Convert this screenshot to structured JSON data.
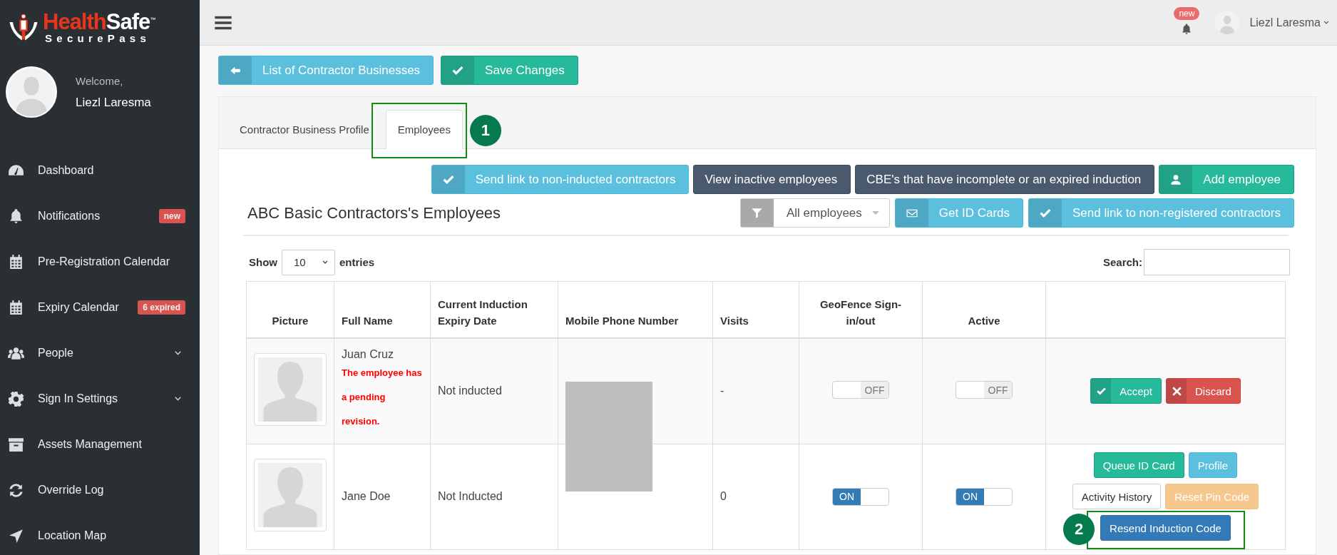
{
  "logo": {
    "name_red": "Health",
    "name_white": "Safe",
    "trademark": "™",
    "tagline": "SecurePass"
  },
  "profile": {
    "greeting": "Welcome,",
    "name": "Liezl Laresma"
  },
  "sidebar": {
    "items": [
      {
        "label": "Dashboard"
      },
      {
        "label": "Notifications",
        "badge": "new"
      },
      {
        "label": "Pre-Registration Calendar"
      },
      {
        "label": "Expiry Calendar",
        "badge": "6 expired"
      },
      {
        "label": "People",
        "expandable": true
      },
      {
        "label": "Sign In Settings",
        "expandable": true
      },
      {
        "label": "Assets Management"
      },
      {
        "label": "Override Log"
      },
      {
        "label": "Location Map"
      }
    ]
  },
  "topbar": {
    "notification_badge": "new",
    "user": "Liezl Laresma"
  },
  "page_actions": [
    {
      "label": "List of Contractor Businesses"
    },
    {
      "label": "Save Changes"
    }
  ],
  "tabs": [
    {
      "label": "Contractor Business Profile",
      "selected": false
    },
    {
      "label": "Employees",
      "selected": true,
      "callout": "1"
    }
  ],
  "toolbar": [
    {
      "label": "Send link to non-inducted contractors"
    },
    {
      "label": "View inactive employees"
    },
    {
      "label": "CBE's that have incomplete or an expired induction"
    },
    {
      "label": "Add employee"
    }
  ],
  "heading": "ABC Basic Contractors's Employees",
  "filter": {
    "value": "All employees"
  },
  "toolbar_2": [
    {
      "label": "Get ID Cards"
    },
    {
      "label": "Send link to non-registered contractors"
    }
  ],
  "length": {
    "prefix": "Show",
    "value": "10",
    "suffix": "entries"
  },
  "search": {
    "label": "Search:"
  },
  "table": {
    "columns": [
      "Picture",
      "Full Name",
      "Current Induction Expiry Date",
      "Mobile Phone Number",
      "Visits",
      "GeoFence Sign-in/out",
      "Active"
    ],
    "rows": [
      {
        "full_name": "Juan Cruz",
        "note": "The employee has a pending revision.",
        "expiry": "Not inducted",
        "visits": "-",
        "geofence": {
          "on": false,
          "label": "OFF"
        },
        "active": {
          "on": false,
          "label": "OFF"
        },
        "actions": [
          [
            {
              "label": "Accept"
            },
            {
              "label": "Discard"
            }
          ]
        ]
      },
      {
        "full_name": "Jane Doe",
        "expiry": "Not Inducted",
        "visits": "0",
        "geofence": {
          "on": true,
          "label": "ON"
        },
        "active": {
          "on": true,
          "label": "ON"
        },
        "actions": [
          [
            {
              "label": "Queue ID Card"
            },
            {
              "label": "Profile"
            }
          ],
          [
            {
              "label": "Activity History"
            },
            {
              "label": "Reset Pin Code"
            }
          ],
          [
            {
              "label": "Resend Induction Code",
              "callout": "2"
            }
          ]
        ]
      }
    ]
  }
}
